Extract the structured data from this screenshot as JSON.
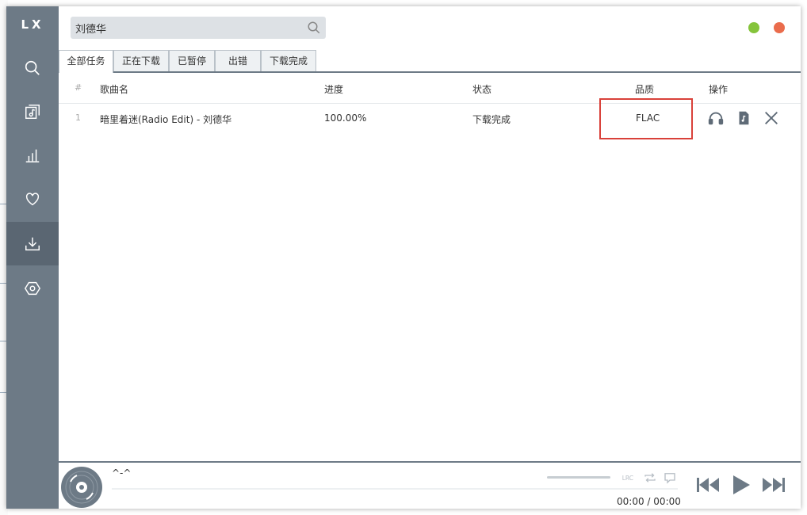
{
  "app": {
    "logo": "LX"
  },
  "colors": {
    "sidebar": "#6d7a86",
    "sidebar_active": "#5a6672",
    "minimize": "#85c43b",
    "close": "#ea6c4c",
    "highlight": "#d9413a"
  },
  "sidebar": {
    "items": [
      {
        "name": "search",
        "icon": "search-icon"
      },
      {
        "name": "song-list",
        "icon": "music-list-icon"
      },
      {
        "name": "leaderboard",
        "icon": "chart-icon"
      },
      {
        "name": "favorites",
        "icon": "heart-icon"
      },
      {
        "name": "download",
        "icon": "download-icon",
        "active": true
      },
      {
        "name": "settings",
        "icon": "settings-icon"
      }
    ]
  },
  "search": {
    "value": "刘德华",
    "placeholder": ""
  },
  "tabs": [
    {
      "label": "全部任务",
      "active": true
    },
    {
      "label": "正在下载"
    },
    {
      "label": "已暂停"
    },
    {
      "label": "出错"
    },
    {
      "label": "下载完成"
    }
  ],
  "table": {
    "headers": {
      "num": "#",
      "name": "歌曲名",
      "progress": "进度",
      "status": "状态",
      "quality": "品质",
      "actions": "操作"
    },
    "rows": [
      {
        "num": "1",
        "name": "暗里着迷(Radio Edit) - 刘德华",
        "progress": "100.00%",
        "status": "下载完成",
        "quality": "FLAC",
        "actions": [
          "headphones-icon",
          "file-music-icon",
          "close-icon"
        ]
      }
    ]
  },
  "player": {
    "title": "^-^",
    "current_time": "00:00",
    "separator": "/",
    "total_time": "00:00",
    "progress_fraction": 0,
    "lyric_label": "LRC",
    "controls": [
      "lyric-icon",
      "repeat-icon",
      "comment-icon",
      "prev-icon",
      "play-icon",
      "next-icon"
    ]
  }
}
